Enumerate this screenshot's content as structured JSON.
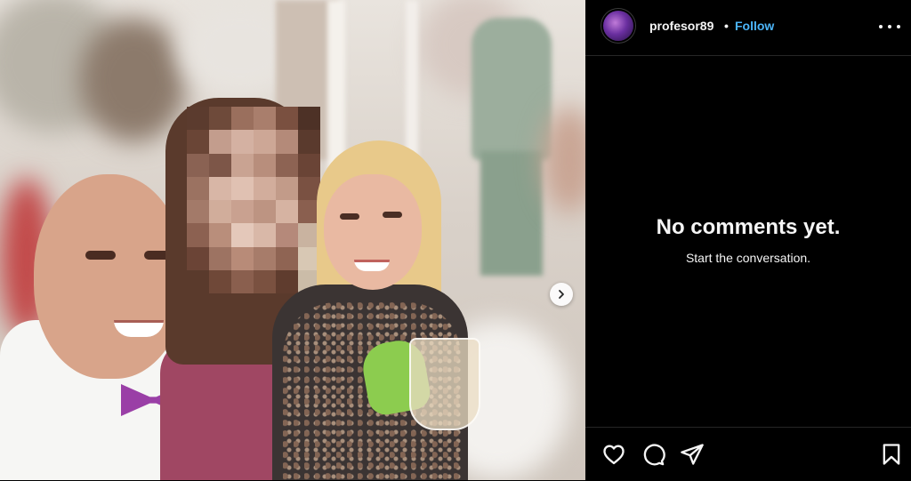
{
  "post": {
    "image_alt": "",
    "carousel_next_icon": "chevron-right-icon"
  },
  "header": {
    "username": "profesor89",
    "separator": "•",
    "follow_label": "Follow",
    "more_icon": "more-horizontal-icon"
  },
  "comments": {
    "empty_title": "No comments yet.",
    "empty_subtitle": "Start the conversation."
  },
  "actions": {
    "like_icon": "heart-icon",
    "comment_icon": "comment-icon",
    "share_icon": "share-icon",
    "save_icon": "bookmark-icon"
  },
  "colors": {
    "background": "#000000",
    "text": "#f5f5f5",
    "follow": "#4cb5f9",
    "divider": "#262626"
  }
}
